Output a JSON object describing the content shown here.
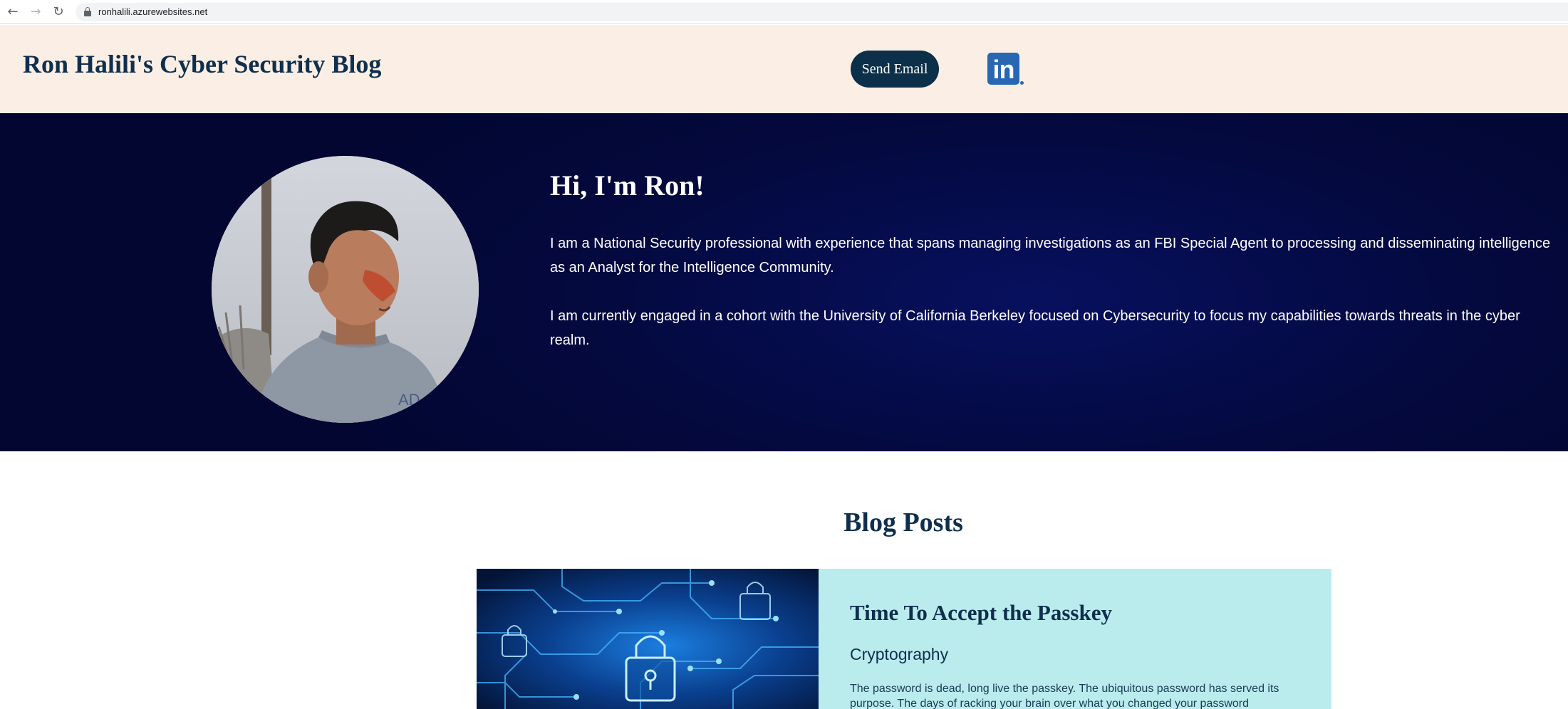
{
  "browser": {
    "url": "ronhalili.azurewebsites.net",
    "icons": [
      "back-arrow-icon",
      "forward-arrow-icon",
      "reload-icon",
      "lock-icon"
    ]
  },
  "header": {
    "title": "Ron Halili's Cyber Security Blog",
    "email_button": "Send Email",
    "linkedin_text": "in",
    "colors": {
      "background": "#fbefe5",
      "title": "#0f2f4d",
      "button": "#0c3049",
      "linkedin": "#2867b2"
    }
  },
  "hero": {
    "heading": "Hi, I'm Ron!",
    "paragraphs": [
      "I am a National Security professional with experience that spans managing investigations as an FBI Special Agent to processing and disseminating intelligence as an Analyst for the Intelligence Community.",
      "I am currently engaged in a cohort with the University of California Berkeley focused on Cybersecurity to focus my capabilities towards threats in the cyber realm."
    ],
    "colors": {
      "background": "#04093f",
      "text": "#ffffff"
    }
  },
  "blog": {
    "heading": "Blog Posts",
    "posts": [
      {
        "title": "Time To Accept the Passkey",
        "category": "Cryptography",
        "excerpt": "The password is dead, long live the passkey. The ubiquitous password has served its purpose. The days of racking your brain over what you changed your password",
        "image": "circuit-padlock-image"
      }
    ],
    "colors": {
      "card_background": "#baeced"
    }
  }
}
